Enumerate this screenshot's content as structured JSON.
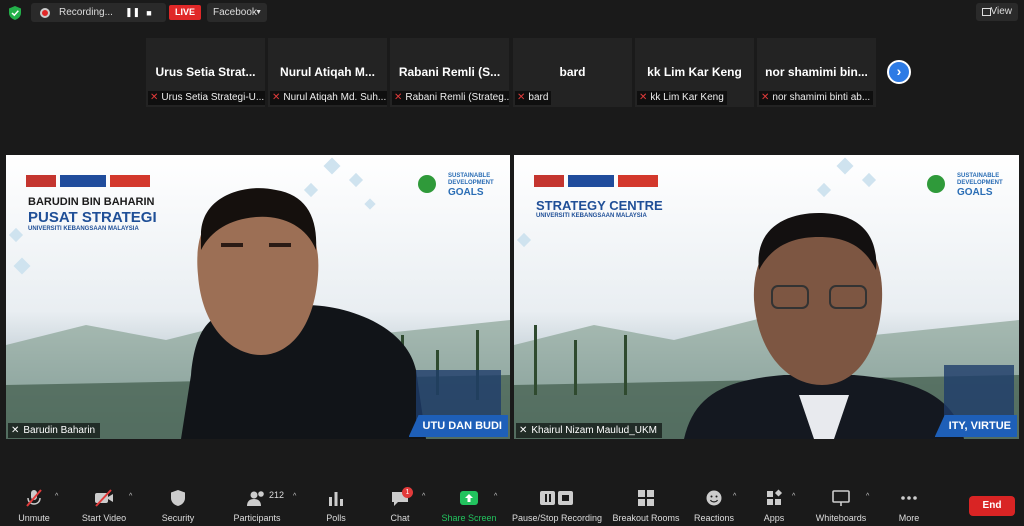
{
  "topbar": {
    "recording_label": "Recording...",
    "pause_icon": "pause-icon",
    "stop_icon": "stop-icon",
    "live_label": "LIVE",
    "stream_target": "Facebook",
    "view_label": "View"
  },
  "participants": [
    {
      "name": "Urus Setia Strat...",
      "label": "Urus Setia Strategi-U..."
    },
    {
      "name": "Nurul Atiqah M...",
      "label": "Nurul Atiqah Md. Suh..."
    },
    {
      "name": "Rabani Remli (S...",
      "label": "Rabani Remli (Strateg..."
    },
    {
      "name": "bard",
      "label": "bard"
    },
    {
      "name": "kk Lim Kar Keng",
      "label": "kk Lim Kar Keng"
    },
    {
      "name": "nor shamimi bin...",
      "label": "nor shamimi binti ab..."
    }
  ],
  "videos": [
    {
      "name": "Barudin Baharin",
      "banner_name": "BARUDIN BIN BAHARIN",
      "banner_title": "PUSAT STRATEGI",
      "banner_sub": "UNIVERSITI KEBANGSAAN MALAYSIA",
      "slogan": "UTU DAN BUDI"
    },
    {
      "name": "Khairul Nizam Maulud_UKM",
      "banner_name": "",
      "banner_title": "STRATEGY CENTRE",
      "banner_sub": "UNIVERSITI KEBANGSAAN MALAYSIA",
      "slogan": "ITY, VIRTUE"
    }
  ],
  "sdg": {
    "line1": "SUSTAINABLE",
    "line2": "DEVELOPMENT",
    "line3": "GOALS"
  },
  "toolbar": {
    "unmute": "Unmute",
    "start_video": "Start Video",
    "security": "Security",
    "participants": "Participants",
    "participants_count": "212",
    "polls": "Polls",
    "chat": "Chat",
    "chat_badge": "1",
    "share_screen": "Share Screen",
    "pause_stop_recording": "Pause/Stop Recording",
    "breakout_rooms": "Breakout Rooms",
    "reactions": "Reactions",
    "apps": "Apps",
    "whiteboards": "Whiteboards",
    "more": "More",
    "end": "End"
  },
  "colors": {
    "live": "#e02828",
    "share_green": "#22c35e",
    "end_red": "#d92424",
    "accent_blue": "#2d7be5"
  }
}
